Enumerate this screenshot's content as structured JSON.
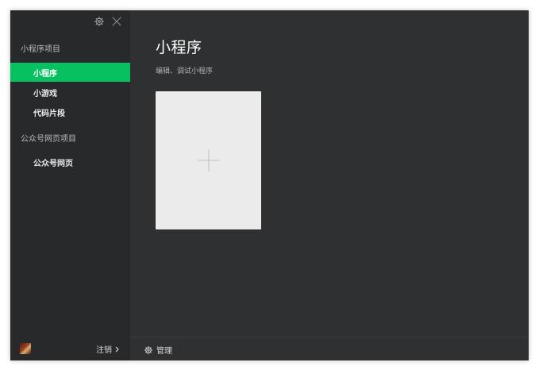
{
  "sidebar": {
    "sections": [
      {
        "label": "小程序项目"
      },
      {
        "label": "公众号网页项目"
      }
    ],
    "items": [
      {
        "label": "小程序",
        "active": true
      },
      {
        "label": "小游戏",
        "active": false
      },
      {
        "label": "代码片段",
        "active": false
      },
      {
        "label": "公众号网页",
        "active": false
      }
    ],
    "logout_label": "注销",
    "logout_icon": "chevron-right-icon"
  },
  "main": {
    "title": "小程序",
    "subtitle": "编辑、调试小程序",
    "manage_label": "管理"
  },
  "colors": {
    "accent": "#07c160",
    "sidebar_bg": "#27292a",
    "main_bg": "#2f3031",
    "card_bg": "#ebebeb"
  },
  "icons": [
    "settings-icon",
    "close-icon",
    "plus-icon",
    "gear-icon",
    "avatar"
  ]
}
